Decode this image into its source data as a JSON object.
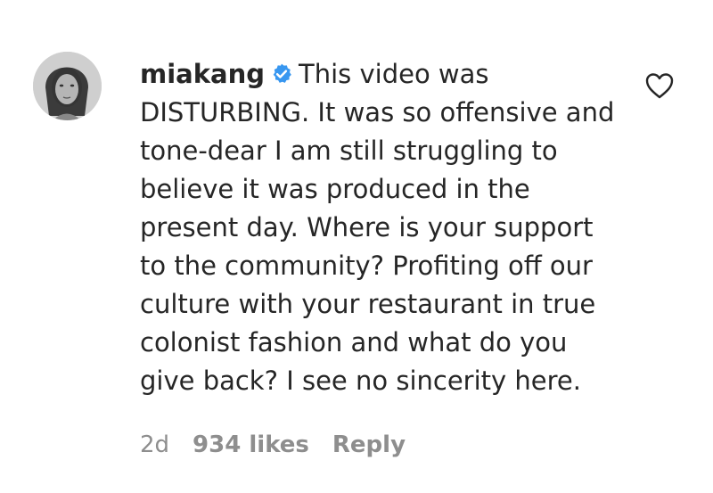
{
  "comment": {
    "username": "miakang",
    "verified": true,
    "text": "This video was DISTURBING. It was so offensive and tone-dear I am still struggling to believe it was produced in the present day. Where is your support to the community? Profiting off our culture with your restaurant in true colonist fashion and what do you give back? I see no sincerity here.",
    "timestamp": "2d",
    "likes": "934 likes",
    "reply_label": "Reply"
  },
  "icons": {
    "verified": "verified-badge-icon",
    "like": "heart-outline-icon"
  },
  "colors": {
    "text": "#262626",
    "meta": "#8e8e8e",
    "verified_blue": "#3897f0"
  }
}
